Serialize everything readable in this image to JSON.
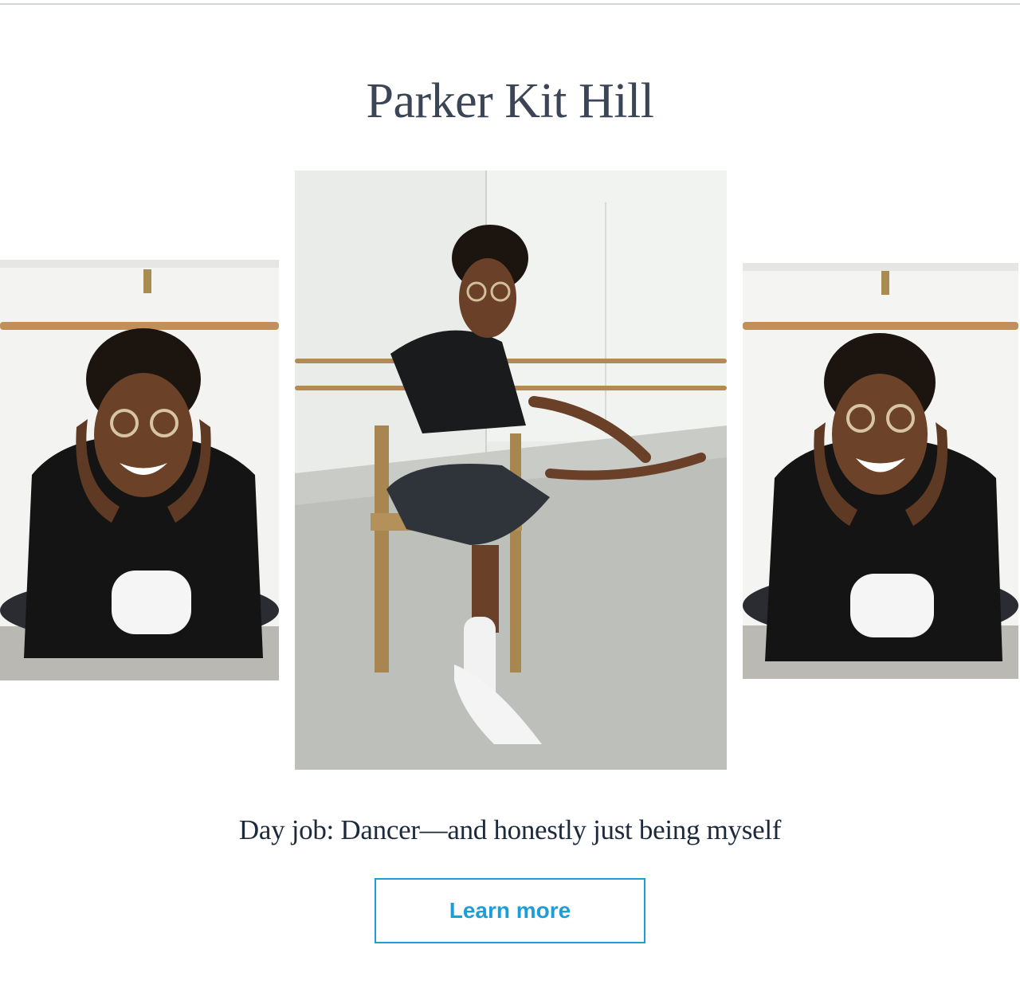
{
  "profile": {
    "name": "Parker Kit Hill",
    "tagline": "Day job: Dancer—and honestly just being myself",
    "cta_label": "Learn more"
  },
  "photos": [
    {
      "subject": "dancer-smiling-hands-on-cheeks"
    },
    {
      "subject": "dancer-seated-on-folding-chair"
    },
    {
      "subject": "dancer-laughing-hands-on-cheeks"
    }
  ],
  "colors": {
    "title": "#3b4555",
    "tagline": "#1d2a3c",
    "accent": "#1e9ed8",
    "divider": "#d3d6d9"
  }
}
